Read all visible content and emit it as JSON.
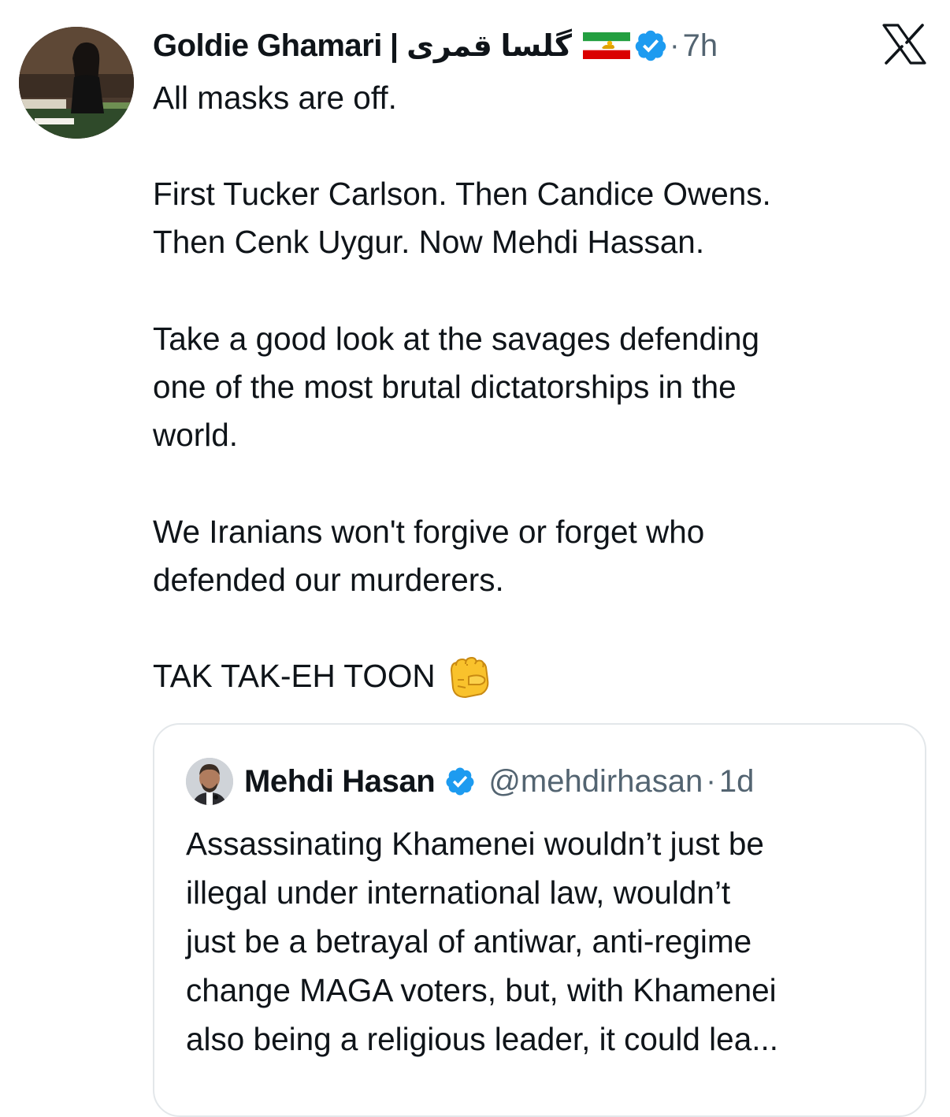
{
  "tweet": {
    "author_name": "Goldie Ghamari",
    "separator": "|",
    "author_name_farsi": "گلسا قمری",
    "time_separator": "·",
    "time": "7h",
    "paragraphs": [
      "All masks are off.",
      "First Tucker Carlson. Then Candice Owens.\nThen Cenk Uygur. Now Mehdi Hassan.",
      "Take a good look at the savages defending\none of the most brutal dictatorships in the\nworld.",
      "We Iranians won't forgive or forget who\ndefended our murderers.",
      "TAK TAK-EH TOON"
    ],
    "emoji_icon": "backhand-index-pointing-fist-icon"
  },
  "quoted_tweet": {
    "author_name": "Mehdi Hasan",
    "handle": "@mehdirhasan",
    "time_separator": "·",
    "time": "1d",
    "text": "Assassinating Khamenei wouldn’t just be\nillegal under international law, wouldn’t\njust be a betrayal of antiwar, anti-regime\nchange MAGA voters, but, with Khamenei\nalso being a religious leader, it could lea..."
  },
  "icons": {
    "x_logo": "x-logo-icon",
    "verified": "verified-badge-icon",
    "flag": "iran-lion-and-sun-flag-icon"
  },
  "colors": {
    "text": "#0f1419",
    "secondary": "#536471",
    "verified_blue": "#1d9bf0",
    "border": "#e3e7ea"
  }
}
